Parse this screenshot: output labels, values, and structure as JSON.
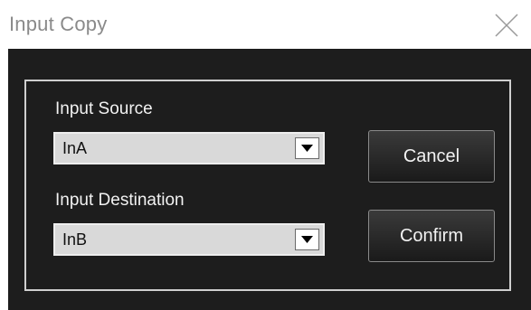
{
  "window": {
    "title": "Input Copy"
  },
  "source": {
    "label": "Input Source",
    "value": "InA"
  },
  "destination": {
    "label": "Input Destination",
    "value": "InB"
  },
  "buttons": {
    "cancel": "Cancel",
    "confirm": "Confirm"
  },
  "icons": {
    "close": "close-icon",
    "dropdown": "chevron-down-icon"
  },
  "colors": {
    "client_bg": "#1d1d1d",
    "text_light": "#f2f2f2",
    "title_text": "#8a8a8a"
  }
}
